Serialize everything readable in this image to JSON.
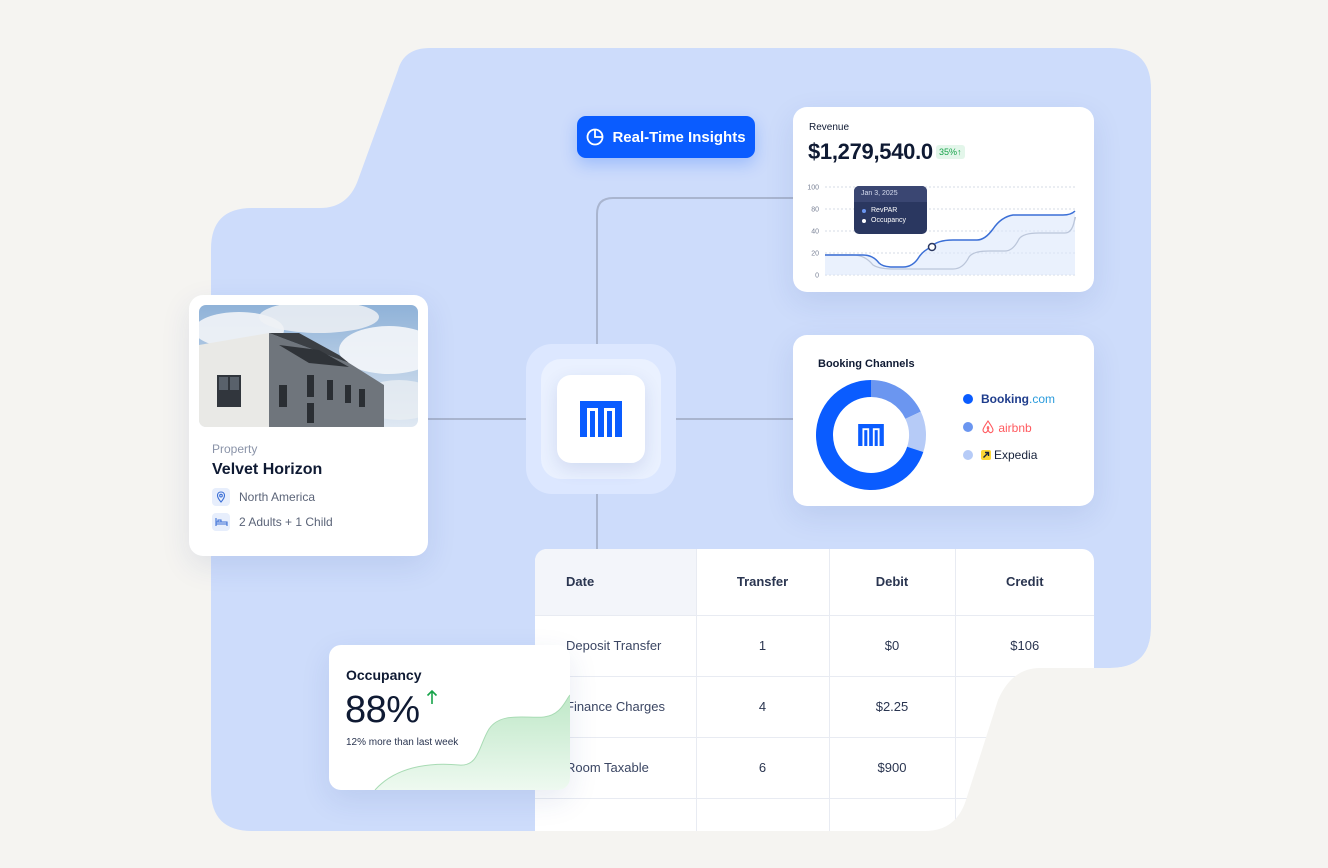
{
  "insights_button": {
    "label": "Real-Time Insights",
    "icon": "pie-chart-icon"
  },
  "revenue": {
    "label": "Revenue",
    "amount": "$1,279,540.0",
    "change": "35%↑",
    "tooltip": {
      "date": "Jan 3, 2025",
      "series": [
        "RevPAR",
        "Occupancy"
      ]
    },
    "chart_data": {
      "type": "line",
      "y_ticks": [
        "100",
        "80",
        "40",
        "20",
        "0"
      ],
      "series": [
        {
          "name": "RevPAR",
          "color": "#3b6fd6"
        },
        {
          "name": "Occupancy",
          "color": "#8a93a8"
        }
      ]
    }
  },
  "booking": {
    "title": "Booking Channels",
    "channels": [
      {
        "name": "Booking",
        "suffix": ".com",
        "color": "#0a5cff"
      },
      {
        "name": "airbnb",
        "color": "#6b96f0"
      },
      {
        "name": "Expedia",
        "color": "#b6cbf7"
      }
    ],
    "chart_data": {
      "type": "pie",
      "values": [
        70,
        18,
        12
      ]
    }
  },
  "property": {
    "label": "Property",
    "name": "Velvet Horizon",
    "location": "North America",
    "guests": "2 Adults + 1 Child"
  },
  "table": {
    "headers": [
      "Date",
      "Transfer",
      "Debit",
      "Credit"
    ],
    "rows": [
      [
        "Deposit Transfer",
        "1",
        "$0",
        "$106"
      ],
      [
        "Finance Charges",
        "4",
        "$2.25",
        ""
      ],
      [
        "Room Taxable",
        "6",
        "$900",
        ""
      ],
      [
        "",
        "",
        "",
        ""
      ]
    ]
  },
  "occupancy": {
    "title": "Occupancy",
    "value": "88%",
    "subtitle": "12% more than last week"
  },
  "colors": {
    "accent": "#0a5cff",
    "background_blob": "#cddcfb",
    "positive": "#17a34a"
  }
}
